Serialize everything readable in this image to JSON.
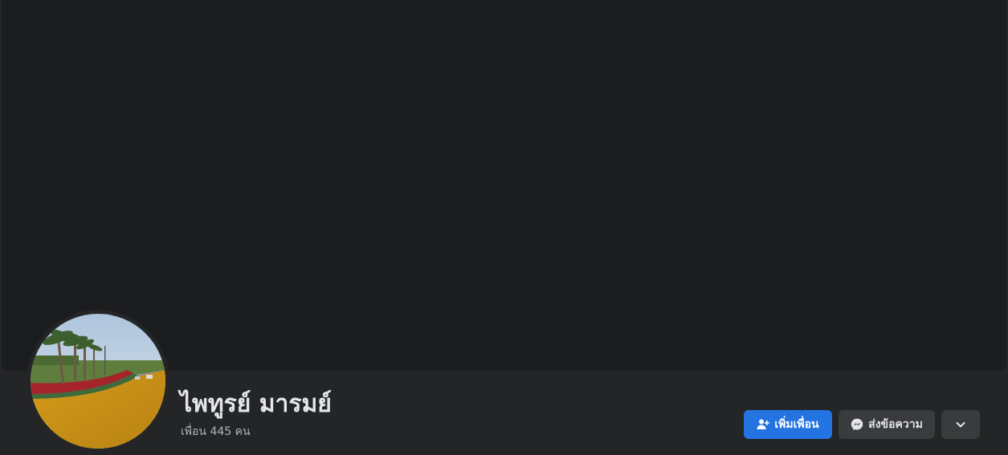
{
  "profile": {
    "name": "ไพทูรย์ มารมย์",
    "friends_text": "เพื่อน 445 คน",
    "avatar_description": "palm trees beside road with red running track"
  },
  "actions": {
    "add_friend_label": "เพิ่มเพื่อน",
    "message_label": "ส่งข้อความ",
    "more_icon": "chevron-down-icon",
    "add_friend_icon": "user-plus-icon",
    "message_icon": "messenger-icon"
  },
  "colors": {
    "background": "#242526",
    "cover": "#1b1c1e",
    "primary_button": "#2374e1",
    "secondary_button": "#3a3b3c",
    "text_primary": "#e4e6eb",
    "text_secondary": "#b0b3b8"
  }
}
